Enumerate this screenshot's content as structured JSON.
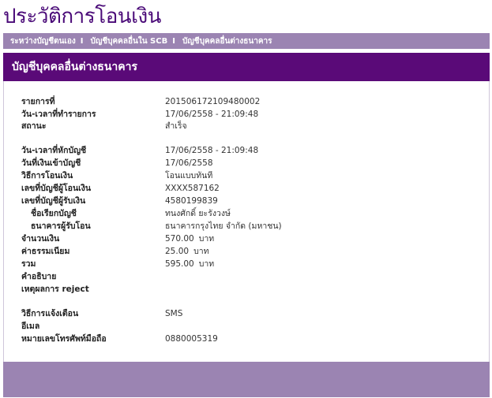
{
  "page": {
    "title": "ประวัติการโอนเงิน"
  },
  "subnav": {
    "items": [
      {
        "label": "ระหว่างบัญชีตนเอง"
      },
      {
        "label": "บัญชีบุคคลอื่นใน SCB"
      },
      {
        "label": "บัญชีบุคคลอื่นต่างธนาคาร"
      }
    ],
    "separator": "I"
  },
  "header": {
    "title": "บัญชีบุคคลอื่นต่างธนาคาร"
  },
  "details": {
    "ref_label": "รายการที่",
    "ref_value": "201506172109480002",
    "txn_datetime_label": "วัน-เวลาที่ทำรายการ",
    "txn_datetime_value": "17/06/2558 - 21:09:48",
    "status_label": "สถานะ",
    "status_value": "สำเร็จ",
    "debit_datetime_label": "วัน-เวลาที่หักบัญชี",
    "debit_datetime_value": "17/06/2558 - 21:09:48",
    "credit_date_label": "วันที่เงินเข้าบัญชี",
    "credit_date_value": "17/06/2558",
    "method_label": "วิธีการโอนเงิน",
    "method_value": "โอนแบบทันที",
    "from_account_label": "เลขที่บัญชีผู้โอนเงิน",
    "from_account_value": "XXXX587162",
    "to_account_label": "เลขที่บัญชีผู้รับเงิน",
    "to_account_value": "4580199839",
    "account_name_label": "ชื่อเรียกบัญชี",
    "account_name_value": "ทนงศักดิ์ ยะรังวงษ์",
    "bank_label": "ธนาคารผู้รับโอน",
    "bank_value": "ธนาคารกรุงไทย จำกัด (มหาชน)",
    "amount_label": "จำนวนเงิน",
    "amount_value": "570.00",
    "fee_label": "ค่าธรรมเนียม",
    "fee_value": "25.00",
    "total_label": "รวม",
    "total_value": "595.00",
    "currency_unit": "บาท",
    "description_label": "คำอธิบาย",
    "reject_label": "เหตุผลการ reject",
    "notify_method_label": "วิธีการแจ้งเตือน",
    "notify_method_value": "SMS",
    "email_label": "อีเมล",
    "mobile_label": "หมายเลขโทรศัพท์มือถือ",
    "mobile_value": "0880005319"
  }
}
